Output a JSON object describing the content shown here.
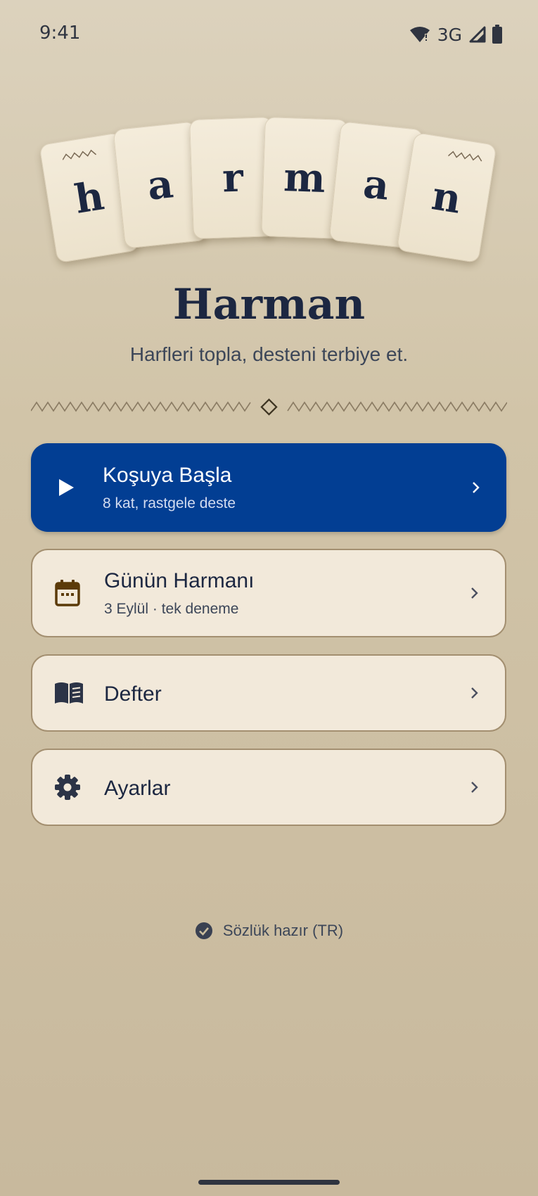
{
  "status_bar": {
    "time": "9:41",
    "network": "3G"
  },
  "logo_letters": [
    "h",
    "a",
    "r",
    "m",
    "a",
    "n"
  ],
  "app": {
    "title": "Harman",
    "subtitle": "Harfleri topla, desteni terbiye et."
  },
  "menu": [
    {
      "title": "Koşuya Başla",
      "subtitle": "8 kat, rastgele deste",
      "icon": "play-icon",
      "style": "primary"
    },
    {
      "title": "Günün Harmanı",
      "subtitle": "3 Eylül · tek deneme",
      "icon": "calendar-icon",
      "style": "secondary"
    },
    {
      "title": "Defter",
      "icon": "book-icon",
      "style": "secondary"
    },
    {
      "title": "Ayarlar",
      "icon": "gear-icon",
      "style": "secondary"
    }
  ],
  "footer": {
    "status": "Sözlük hazır (TR)",
    "icon": "check-circle-icon"
  },
  "colors": {
    "primary": "#023e93",
    "card_bg": "#f2e9da",
    "card_border": "#a38f70",
    "text_dark": "#1c2741",
    "background": "#d1c4a8"
  }
}
